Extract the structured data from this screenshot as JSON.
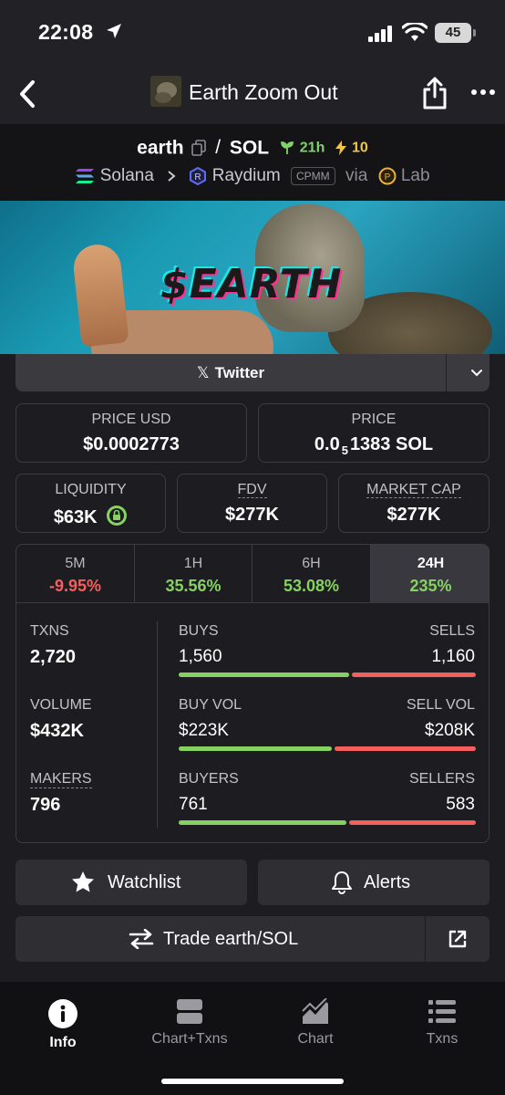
{
  "status_bar": {
    "time": "22:08",
    "battery": "45"
  },
  "nav": {
    "title": "Earth Zoom Out"
  },
  "pair": {
    "base": "earth",
    "separator": "/",
    "quote": "SOL",
    "age": "21h",
    "boosts": "10",
    "chain": "Solana",
    "dex": "Raydium",
    "pool_type": "CPMM",
    "via_word": "via",
    "launchpad": "Lab"
  },
  "banner": {
    "logo_text": "$EARTH"
  },
  "twitter": {
    "label": "Twitter"
  },
  "stats": {
    "price_usd": {
      "label": "PRICE USD",
      "value": "$0.0002773"
    },
    "price": {
      "label": "PRICE",
      "value_prefix": "0.0",
      "value_sub": "5",
      "value_suffix": "1383 SOL"
    },
    "liquidity": {
      "label": "LIQUIDITY",
      "value": "$63K"
    },
    "fdv": {
      "label": "FDV",
      "value": "$277K"
    },
    "market_cap": {
      "label": "MARKET CAP",
      "value": "$277K"
    }
  },
  "timeframes": [
    {
      "label": "5M",
      "value": "-9.95%",
      "trend": "down"
    },
    {
      "label": "1H",
      "value": "35.56%",
      "trend": "up"
    },
    {
      "label": "6H",
      "value": "53.08%",
      "trend": "up"
    },
    {
      "label": "24H",
      "value": "235%",
      "trend": "up",
      "active": true
    }
  ],
  "activity": {
    "txns": {
      "label": "TXNS",
      "value": "2,720"
    },
    "volume": {
      "label": "VOLUME",
      "value": "$432K"
    },
    "makers": {
      "label": "MAKERS",
      "value": "796"
    },
    "buys": {
      "left_label": "BUYS",
      "left_value": "1,560",
      "right_label": "SELLS",
      "right_value": "1,160",
      "left_share": 0.574
    },
    "vol": {
      "left_label": "BUY VOL",
      "left_value": "$223K",
      "right_label": "SELL VOL",
      "right_value": "$208K",
      "left_share": 0.517
    },
    "makers_split": {
      "left_label": "BUYERS",
      "left_value": "761",
      "right_label": "SELLERS",
      "right_value": "583",
      "left_share": 0.566
    }
  },
  "actions": {
    "watchlist": "Watchlist",
    "alerts": "Alerts",
    "trade": "Trade earth/SOL"
  },
  "tabbar": [
    {
      "label": "Info",
      "icon": "info-icon",
      "active": true
    },
    {
      "label": "Chart+Txns",
      "icon": "chart-txns-icon"
    },
    {
      "label": "Chart",
      "icon": "chart-icon"
    },
    {
      "label": "Txns",
      "icon": "list-icon"
    }
  ],
  "colors": {
    "positive": "#86d161",
    "negative": "#f25f5c",
    "boost": "#f2c641",
    "age": "#7fd36b"
  }
}
